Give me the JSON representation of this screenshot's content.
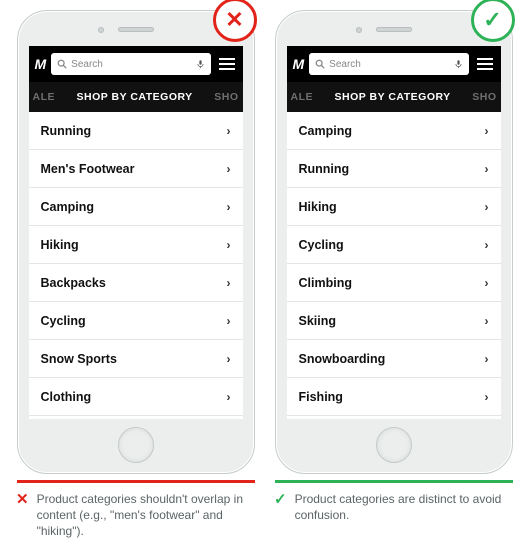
{
  "search": {
    "placeholder": "Search"
  },
  "subnav": {
    "left": "ALE",
    "title": "SHOP BY CATEGORY",
    "right": "SHO"
  },
  "bad": {
    "categories": [
      "Running",
      "Men's Footwear",
      "Camping",
      "Hiking",
      "Backpacks",
      "Cycling",
      "Snow Sports",
      "Clothing"
    ],
    "caption": "Product categories shouldn't overlap in content (e.g., \"men's footwear\" and \"hiking\")."
  },
  "good": {
    "categories": [
      "Camping",
      "Running",
      "Hiking",
      "Cycling",
      "Climbing",
      "Skiing",
      "Snowboarding",
      "Fishing"
    ],
    "caption": "Product categories are distinct to avoid confusion."
  }
}
